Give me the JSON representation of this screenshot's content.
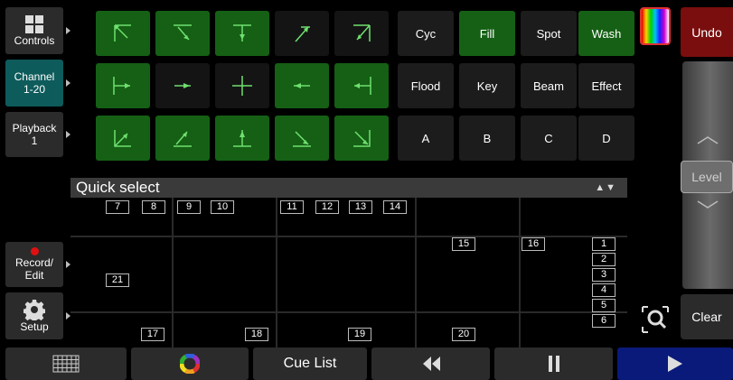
{
  "sidebar": {
    "controls": "Controls",
    "channel_line1": "Channel",
    "channel_line2": "1-20",
    "playback_line1": "Playback",
    "playback_line2": "1",
    "record_line1": "Record/",
    "record_line2": "Edit",
    "setup": "Setup"
  },
  "groups": {
    "cyc": "Cyc",
    "fill": "Fill",
    "spot": "Spot",
    "wash": "Wash",
    "flood": "Flood",
    "key": "Key",
    "beam": "Beam",
    "effect": "Effect",
    "a": "A",
    "b": "B",
    "c": "C",
    "d": "D"
  },
  "quick_select": {
    "title": "Quick select",
    "arrows": "▲▼",
    "channels": [
      "7",
      "8",
      "9",
      "10",
      "11",
      "12",
      "13",
      "14",
      "15",
      "16",
      "21",
      "17",
      "18",
      "19",
      "20",
      "1",
      "2",
      "3",
      "4",
      "5",
      "6"
    ]
  },
  "right": {
    "undo": "Undo",
    "level": "Level",
    "clear": "Clear"
  },
  "bottom": {
    "cue_list": "Cue List"
  },
  "colors": {
    "green_on": "#156015",
    "channel_teal": "#0e5b5b",
    "undo_red": "#7a0e0e",
    "play_blue": "#0a1a7a"
  }
}
